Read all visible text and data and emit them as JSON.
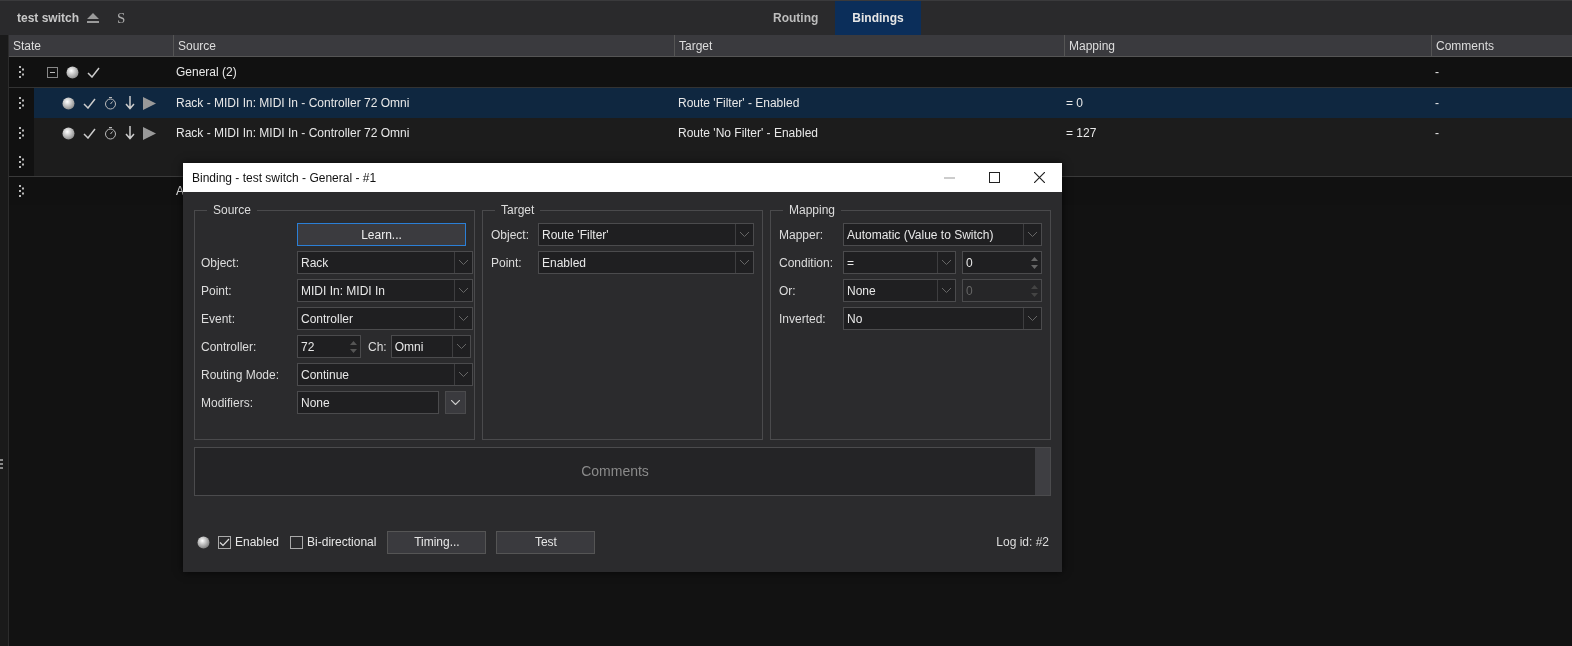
{
  "header": {
    "title": "test switch",
    "shortcut": "S",
    "tabs": [
      {
        "label": "Routing",
        "selected": false
      },
      {
        "label": "Bindings",
        "selected": true
      }
    ]
  },
  "table": {
    "columns": [
      "State",
      "Source",
      "Target",
      "Mapping",
      "Comments"
    ],
    "rows": [
      {
        "kind": "group",
        "expanded": true,
        "enabled": true,
        "source": "General (2)",
        "comments": "-"
      },
      {
        "kind": "binding",
        "selected": true,
        "enabled": true,
        "source": "Rack - MIDI In: MIDI In - Controller 72 Omni",
        "target": "Route 'Filter' - Enabled",
        "mapping": "= 0",
        "comments": "-"
      },
      {
        "kind": "binding",
        "selected": false,
        "enabled": true,
        "source": "Rack - MIDI In: MIDI In - Controller 72 Omni",
        "target": "Route 'No Filter' - Enabled",
        "mapping": "= 127",
        "comments": "-"
      },
      {
        "kind": "add"
      },
      {
        "kind": "add-group",
        "source": "A"
      }
    ]
  },
  "dialog": {
    "title": "Binding - test switch - General - #1",
    "source": {
      "title": "Source",
      "learn": "Learn...",
      "fields": [
        {
          "kind": "select",
          "label": "Object:",
          "value": "Rack"
        },
        {
          "kind": "select",
          "label": "Point:",
          "value": "MIDI In: MIDI In"
        },
        {
          "kind": "select",
          "label": "Event:",
          "value": "Controller"
        },
        {
          "kind": "controller",
          "label": "Controller:",
          "value": "72",
          "channel_label": "Ch:",
          "channel": "Omni"
        },
        {
          "kind": "select",
          "label": "Routing Mode:",
          "value": "Continue"
        },
        {
          "kind": "menu",
          "label": "Modifiers:",
          "value": "None"
        }
      ]
    },
    "target": {
      "title": "Target",
      "fields": [
        {
          "kind": "select",
          "label": "Object:",
          "value": "Route 'Filter'"
        },
        {
          "kind": "select",
          "label": "Point:",
          "value": "Enabled"
        }
      ]
    },
    "mapping": {
      "title": "Mapping",
      "fields": [
        {
          "kind": "select",
          "label": "Mapper:",
          "value": "Automatic (Value to Switch)"
        },
        {
          "kind": "pair",
          "label": "Condition:",
          "value": "=",
          "number": "0",
          "disabled": false
        },
        {
          "kind": "pair",
          "label": "Or:",
          "value": "None",
          "number": "0",
          "disabled": true
        },
        {
          "kind": "select",
          "label": "Inverted:",
          "value": "No"
        }
      ]
    },
    "comments": {
      "placeholder": "Comments"
    },
    "enabled": {
      "label": "Enabled",
      "checked": true
    },
    "bidirectional": {
      "label": "Bi-directional",
      "checked": false
    },
    "buttons": [
      "Timing...",
      "Test"
    ],
    "log_id": "Log id: #2"
  }
}
